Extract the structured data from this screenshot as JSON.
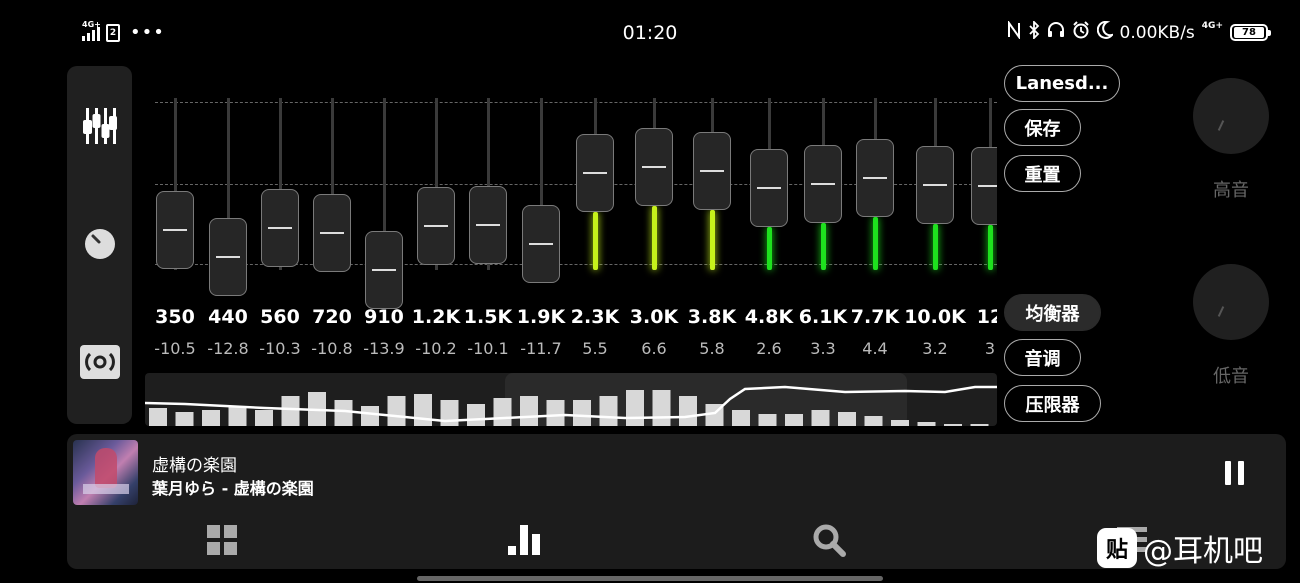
{
  "status_bar": {
    "net_left": "4G+",
    "sim_label": "2",
    "time": "01:20",
    "speed": "0.00KB/s",
    "net_right": "4G+",
    "battery": "78"
  },
  "side_nav": {
    "items": [
      {
        "icon": "equalizer-sliders-icon"
      },
      {
        "icon": "knob-icon"
      },
      {
        "icon": "surround-icon"
      }
    ]
  },
  "eq": {
    "active_color": "#c6f21b",
    "green_color": "#1ee11e",
    "bands": [
      {
        "freq": "350",
        "gain": "-10.5"
      },
      {
        "freq": "440",
        "gain": "-12.8"
      },
      {
        "freq": "560",
        "gain": "-10.3"
      },
      {
        "freq": "720",
        "gain": "-10.8"
      },
      {
        "freq": "910",
        "gain": "-13.9"
      },
      {
        "freq": "1.2K",
        "gain": "-10.2"
      },
      {
        "freq": "1.5K",
        "gain": "-10.1"
      },
      {
        "freq": "1.9K",
        "gain": "-11.7"
      },
      {
        "freq": "2.3K",
        "gain": "5.5"
      },
      {
        "freq": "3.0K",
        "gain": "6.6"
      },
      {
        "freq": "3.8K",
        "gain": "5.8"
      },
      {
        "freq": "4.8K",
        "gain": "2.6"
      },
      {
        "freq": "6.1K",
        "gain": "3.3"
      },
      {
        "freq": "7.7K",
        "gain": "4.4"
      },
      {
        "freq": "10.0K",
        "gain": "3.2"
      },
      {
        "freq": "12",
        "gain": "3"
      }
    ]
  },
  "right_panel": {
    "preset_name": "Lanesd...",
    "save_label": "保存",
    "reset_label": "重置",
    "tab_equalizer": "均衡器",
    "tab_tone": "音调",
    "tab_limiter": "压限器",
    "treble_label": "高音",
    "bass_label": "低音"
  },
  "player": {
    "title": "虚構の楽園",
    "artist_album": "葉月ゆら - 虚構の楽園",
    "nav": [
      {
        "icon": "grid-icon"
      },
      {
        "icon": "equalizer-bars-icon"
      },
      {
        "icon": "search-icon"
      },
      {
        "icon": "menu-icon"
      }
    ]
  },
  "watermark": {
    "logo": "贴",
    "text": "@耳机吧"
  }
}
